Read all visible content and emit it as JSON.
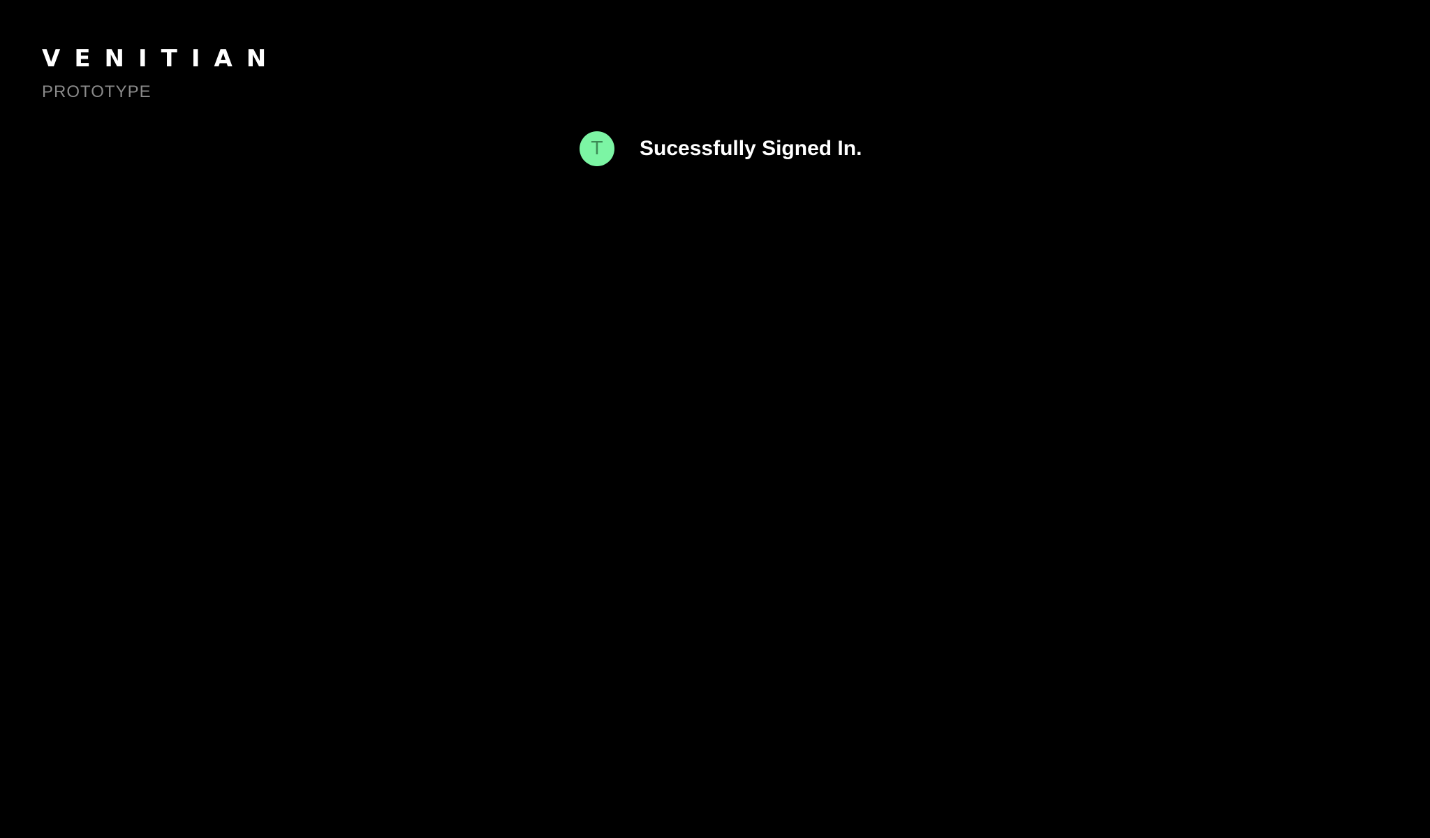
{
  "brand": {
    "name": "VENITIAN",
    "subtitle": "PROTOTYPE"
  },
  "toast": {
    "avatar_initial": "T",
    "message": "Sucessfully Signed In."
  },
  "colors": {
    "background": "#000000",
    "brand_text": "#ffffff",
    "subtitle_text": "#8a8a8a",
    "avatar_bg": "#7cf5a4",
    "avatar_text": "#3c8a55",
    "message_text": "#ffffff"
  }
}
